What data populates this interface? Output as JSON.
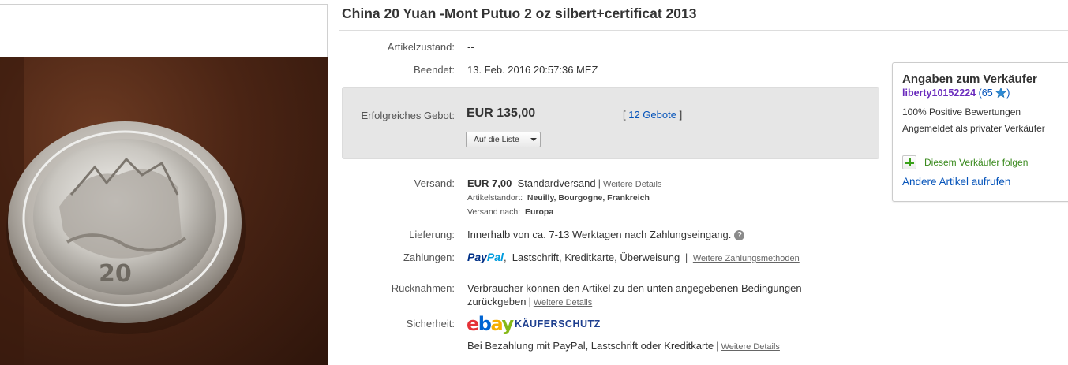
{
  "listing": {
    "title": "China 20 Yuan -Mont Putuo 2 oz silbert+certificat 2013"
  },
  "condition": {
    "label": "Artikelzustand:",
    "value": "--"
  },
  "ended": {
    "label": "Beendet:",
    "value": "13. Feb. 2016  20:57:36 MEZ"
  },
  "bid": {
    "label": "Erfolgreiches Gebot:",
    "price": "EUR 135,00",
    "bids_open": "[ ",
    "bids_link": "12 Gebote",
    "bids_close": " ]",
    "watch_label": "Auf die Liste"
  },
  "shipping": {
    "label": "Versand:",
    "price": "EUR 7,00",
    "method": "Standardversand",
    "details_link": "Weitere Details",
    "location_label": "Artikelstandort:",
    "location_value": "Neuilly, Bourgogne, Frankreich",
    "shipto_label": "Versand nach:",
    "shipto_value": "Europa"
  },
  "delivery": {
    "label": "Lieferung:",
    "value": "Innerhalb von ca. 7-13 Werktagen nach Zahlungseingang."
  },
  "payments": {
    "label": "Zahlungen:",
    "paypal_pay": "Pay",
    "paypal_pal": "Pal",
    "methods": "Lastschrift,  Kreditkarte,  Überweisung",
    "more_link": "Weitere Zahlungsmethoden"
  },
  "returns": {
    "label": "Rücknahmen:",
    "line1": "Verbraucher können den Artikel zu den unten angegebenen Bedingungen",
    "line2": "zurückgeben",
    "details_link": "Weitere Details"
  },
  "security": {
    "label": "Sicherheit:",
    "logo": {
      "e": "e",
      "b": "b",
      "a": "a",
      "y": "y"
    },
    "protection": "KÄUFERSCHUTZ",
    "note": "Bei Bezahlung mit PayPal, Lastschrift oder Kreditkarte",
    "details_link": "Weitere Details"
  },
  "seller": {
    "title": "Angaben zum Verkäufer",
    "username": "liberty10152224",
    "feedback_open": "(",
    "feedback_score": "65",
    "feedback_close": ")",
    "positive": "100% Positive Bewertungen",
    "registered": "Angemeldet als privater Verkäufer",
    "follow_label": "Diesem Verkäufer folgen",
    "other_items": "Andere Artikel aufrufen"
  },
  "photo": {
    "coin_mark": "20"
  },
  "colors": {
    "link": "#0654ba",
    "username": "#6a2bbd",
    "follow": "#3a8a1e",
    "bid_box": "#e6e6e6"
  }
}
